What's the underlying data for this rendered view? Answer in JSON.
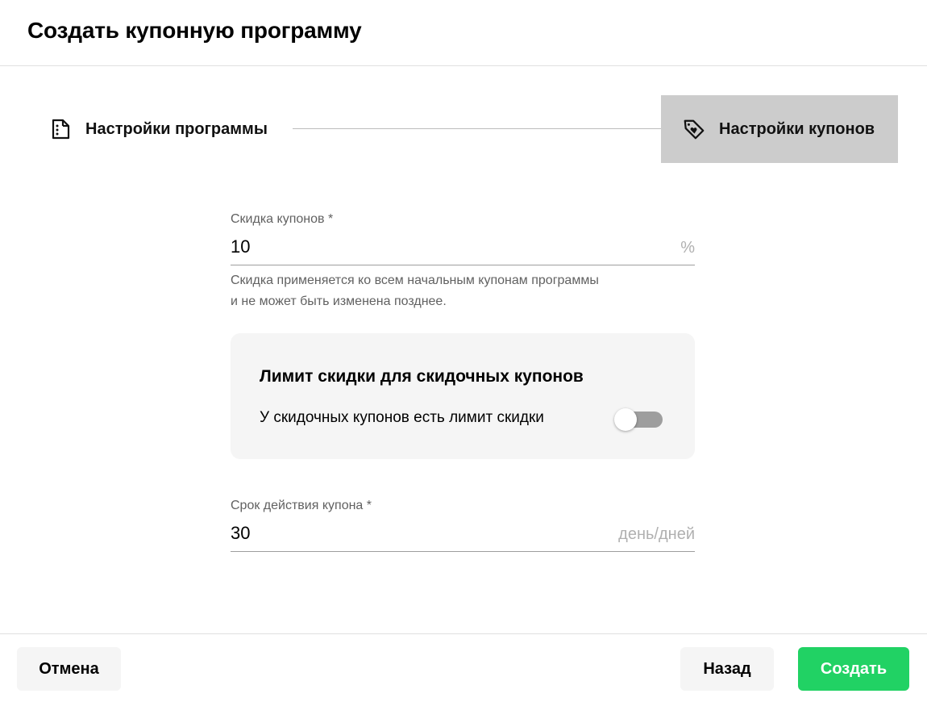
{
  "dialog": {
    "title": "Создать купонную программу"
  },
  "stepper": {
    "steps": [
      {
        "label": "Настройки программы",
        "icon": "document-icon",
        "active": false
      },
      {
        "label": "Настройки купонов",
        "icon": "tag-heart-icon",
        "active": true
      }
    ]
  },
  "discount": {
    "label": "Скидка купонов *",
    "value": "10",
    "suffix": "%",
    "helper_line1": "Скидка применяется ко всем начальным купонам программы",
    "helper_line2": "и не может быть изменена позднее."
  },
  "limit": {
    "title": "Лимит скидки для скидочных купонов",
    "toggle_label": "У скидочных купонов есть лимит скидки",
    "toggle_on": false
  },
  "validity": {
    "label": "Срок действия купона *",
    "value": "30",
    "suffix": "день/дней"
  },
  "footer": {
    "cancel_label": "Отмена",
    "back_label": "Назад",
    "create_label": "Создать"
  },
  "colors": {
    "primary": "#21d264",
    "active_step_bg": "#cccccc",
    "card_bg": "#f5f5f5"
  }
}
